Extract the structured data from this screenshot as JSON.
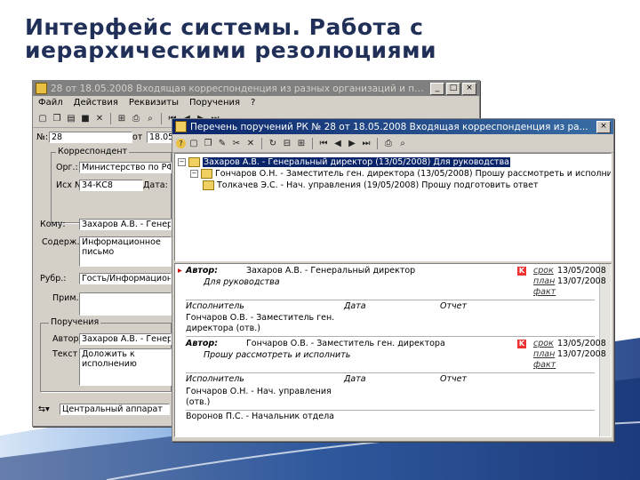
{
  "slide": {
    "title_line1": "Интерфейс системы. Работа с",
    "title_line2": "иерархическими резолюциями"
  },
  "win1": {
    "title": "28 от 18.05.2008 Входящая корреспонденция из разных организаций и пр...",
    "menu": [
      "Файл",
      "Действия",
      "Реквизиты",
      "Поручения",
      "?"
    ],
    "reg_num": "28",
    "from_label": "от",
    "date_value": "18.05.2...",
    "sender_group": "Корреспондент",
    "org_label": "Орг.:",
    "org_value": "Министерство по РФ",
    "out_num_label": "Исх №:",
    "out_num_value": "34-КС8",
    "date_label": "Дата:",
    "signed_label": "Кому:",
    "signed_value": "Захаров А.В. - Генеральный",
    "content_label": "Содерж.:",
    "content_value": "Информационное письмо",
    "rubric_label": "Рубр.:",
    "rubric_value": "Гость/Информационные письма",
    "note_label": "Прим.:",
    "orders_group": "Поручения",
    "author_label": "Автор",
    "author_value": "Захаров А.В. - Генеральный",
    "text_label": "Текст",
    "text_value": "Доложить к исполнению",
    "status_value": "Центральный аппарат"
  },
  "win2": {
    "title": "Перечень поручений РК № 28 от 18.05.2008 Входящая корреспонденция из ра...",
    "tree": [
      "Захаров А.В. - Генеральный директор (13/05/2008) Для руководства",
      "Гончаров О.Н. - Заместитель ген. директора (13/05/2008) Прошу рассмотреть и исполнить",
      "Толкачев Э.С. - Нач. управления (19/05/2008) Прошу подготовить ответ"
    ],
    "detail": {
      "block1": {
        "author_label": "Автор:",
        "author_value": "Захаров А.В. - Генеральный директор",
        "resolution": "Для руководства",
        "srok_label": "срок",
        "srok_date": "13/05/2008",
        "plan_label": "план",
        "plan_date": "13/07/2008",
        "fact_label": "факт",
        "exec_label": "Исполнитель",
        "date_col": "Дата",
        "report_col": "Отчет",
        "executor": "Гончаров О.В. - Заместитель ген.",
        "executor_cont": "директора (отв.)"
      },
      "block2": {
        "author_label": "Автор:",
        "author_value": "Гончаров О.В. - Заместитель ген. директора",
        "resolution": "Прошу рассмотреть и исполнить",
        "srok_label": "срок",
        "srok_date": "13/05/2008",
        "plan_label": "план",
        "plan_date": "13/07/2008",
        "fact_label": "факт",
        "exec_label": "Исполнитель",
        "date_col": "Дата",
        "report_col": "Отчет",
        "executor": "Гончаров О.Н. - Нач. управления",
        "executor_cont": "(отв.)",
        "executor2": "Воронов П.С. - Начальник отдела"
      }
    }
  }
}
